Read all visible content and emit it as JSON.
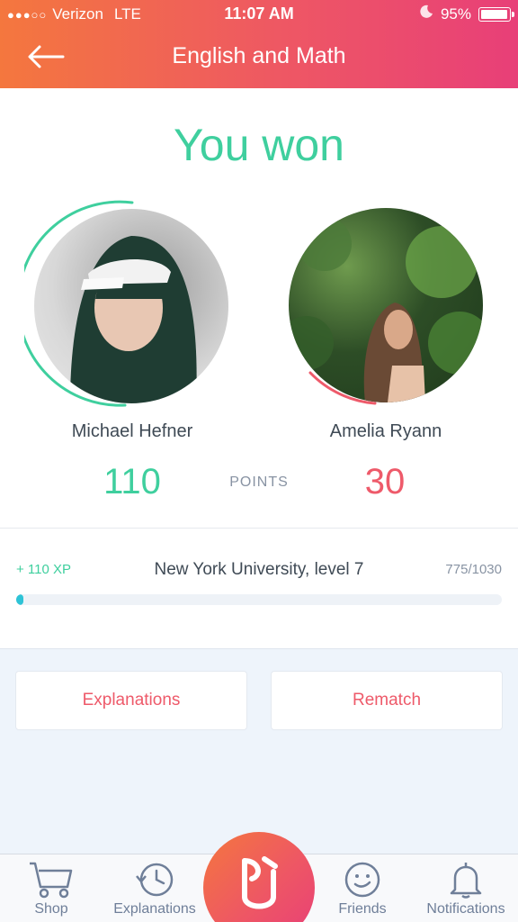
{
  "status_bar": {
    "carrier": "Verizon",
    "network": "LTE",
    "time": "11:07 AM",
    "battery": "95%",
    "battery_level": 0.95
  },
  "header": {
    "title": "English and Math"
  },
  "result": {
    "text": "You won"
  },
  "players": [
    {
      "name": "Michael Hefner",
      "score": "110",
      "ring_color": "#3fcf9e"
    },
    {
      "name": "Amelia Ryann",
      "score": "30",
      "ring_color": "#ee5a6a"
    }
  ],
  "points_label": "POINTS",
  "xp": {
    "gain": "+ 110 XP",
    "level": "New York University, level 7",
    "progress": "775/1030",
    "fill_fraction": 0.015
  },
  "actions": {
    "explanations": "Explanations",
    "rematch": "Rematch"
  },
  "tabs": {
    "shop": "Shop",
    "explanations": "Explanations",
    "friends": "Friends",
    "notifications": "Notifications"
  },
  "colors": {
    "accent_green": "#3fcf9e",
    "accent_red": "#ee5a6a",
    "progress": "#2ec3d6"
  }
}
